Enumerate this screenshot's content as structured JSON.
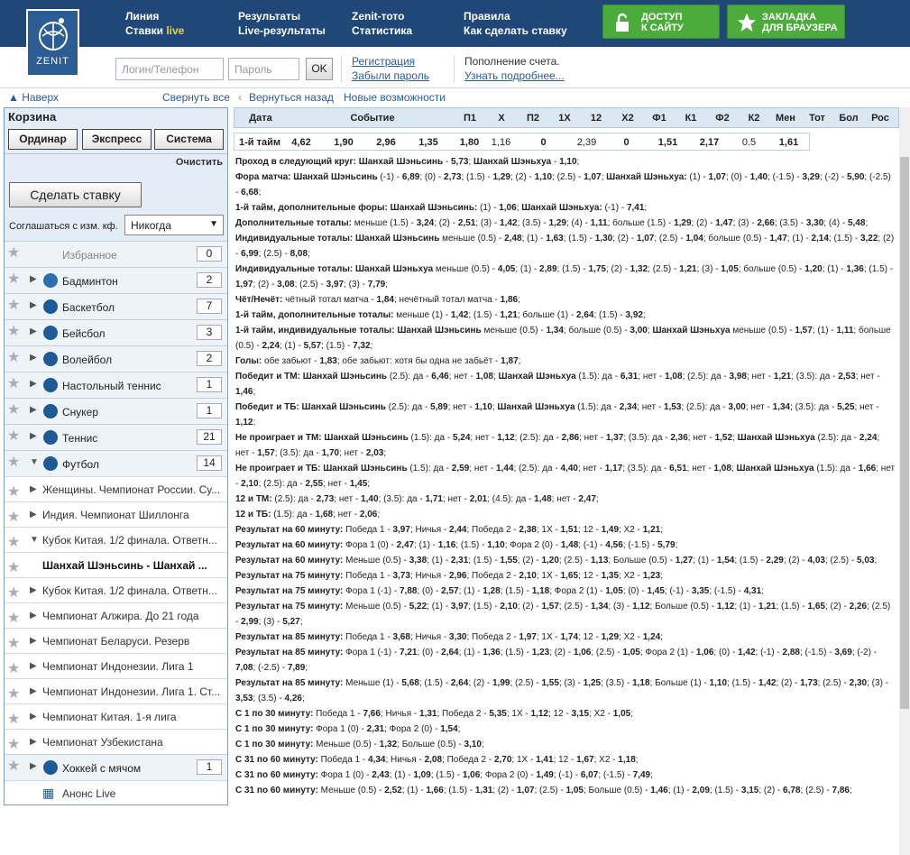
{
  "header": {
    "logo_text": "ZENIT",
    "nav": [
      {
        "l1": "Линия",
        "l2a": "Ставки ",
        "l2b": "live"
      },
      {
        "l1": "Результаты",
        "l2a": "Live-результаты",
        "l2b": ""
      },
      {
        "l1": "Zenit-тото",
        "l2a": "Статистика",
        "l2b": ""
      },
      {
        "l1": "Правила",
        "l2a": "Как сделать ставку",
        "l2b": ""
      }
    ],
    "access_btn": {
      "l1": "Доступ",
      "l2": "к сайту"
    },
    "bookmark_btn": {
      "l1": "Закладка",
      "l2": "для браузера"
    }
  },
  "login": {
    "login_placeholder": "Логин/Телефон",
    "password_placeholder": "Пароль",
    "ok_label": "OK",
    "register": "Регистрация",
    "forgot": "Забыли пароль",
    "topup": "Пополнение счета.",
    "learn_more": "Узнать подробнее..."
  },
  "navrow": {
    "up": "▲ Наверх",
    "collapse": "Свернуть все",
    "back": "Вернуться назад",
    "new_features": "Новые возможности"
  },
  "cart": {
    "title": "Корзина",
    "tabs": [
      "Ординар",
      "Экспресс",
      "Система"
    ],
    "clear": "Очистить",
    "place_bet": "Сделать ставку",
    "agree_label": "Соглашаться с изм. кф.",
    "agree_value": "Никогда"
  },
  "sports": [
    {
      "label": "Избранное",
      "count": "0",
      "color": ""
    },
    {
      "label": "Бадминтон",
      "count": "2",
      "color": "#2b6fb0"
    },
    {
      "label": "Баскетбол",
      "count": "7",
      "color": "#1e5a96"
    },
    {
      "label": "Бейсбол",
      "count": "3",
      "color": "#1e5a96"
    },
    {
      "label": "Волейбол",
      "count": "2",
      "color": "#1e5a96"
    },
    {
      "label": "Настольный теннис",
      "count": "1",
      "color": "#1e5a96"
    },
    {
      "label": "Снукер",
      "count": "1",
      "color": "#1e5a96"
    },
    {
      "label": "Теннис",
      "count": "21",
      "color": "#1e5a96"
    },
    {
      "label": "Футбол",
      "count": "14",
      "color": "#1e5a96"
    }
  ],
  "leagues": [
    "Женщины. Чемпионат России. Су...",
    "Индия. Чемпионат Шиллонга",
    "Кубок Китая. 1/2 финала. Ответн...",
    "Шанхай Шэньсинь - Шанхай ...",
    "Кубок Китая. 1/2 финала. Ответн...",
    "Чемпионат Алжира. До 21 года",
    "Чемпионат Беларуси. Резерв",
    "Чемпионат Индонезии. Лига 1",
    "Чемпионат Индонезии. Лига 1. Ст...",
    "Чемпионат Китая. 1-я лига",
    "Чемпионат Узбекистана"
  ],
  "hockey": {
    "label": "Хоккей с мячом",
    "count": "1"
  },
  "announce": "Анонс Live",
  "table": {
    "headers": [
      "Дата",
      "Событие",
      "П1",
      "X",
      "П2",
      "1X",
      "12",
      "X2",
      "Ф1",
      "К1",
      "Ф2",
      "К2",
      "Мен",
      "Тот",
      "Бол",
      "Рос"
    ],
    "row": [
      "1-й тайм",
      "4,62",
      "1,90",
      "2,96",
      "1,35",
      "1,80",
      "1,16",
      "0",
      "2,39",
      "0",
      "1,51",
      "2,17",
      "0.5",
      "1,61"
    ]
  },
  "lines": [
    "<b>Проход в следующий круг:</b> <b>Шанхай Шэньсинь</b> - <b>5,73</b>; <b>Шанхай Шэньхуа</b> - <b>1,10</b>;",
    "<b>Фора матча:</b> <b>Шанхай Шэньсинь</b> (-1) - <b>6,89</b>; (0) - <b>2,73</b>; (1.5) - <b>1,29</b>; (2) - <b>1,10</b>; (2.5) - <b>1,07</b>; <b>Шанхай Шэньхуа:</b> (1) - <b>1,07</b>; (0) - <b>1,40</b>; (-1.5) - <b>3,29</b>; (-2) - <b>5,90</b>; (-2.5) - <b>6,68</b>;",
    "<b>1-й тайм, дополнительные форы:</b> <b>Шанхай Шэньсинь:</b> (1) - <b>1,06</b>; <b>Шанхай Шэньхуа:</b> (-1) - <b>7,41</b>;",
    "<b>Дополнительные тоталы:</b> меньше (1.5) - <b>3,24</b>; (2) - <b>2,51</b>; (3) - <b>1,42</b>; (3.5) - <b>1,29</b>; (4) - <b>1,11</b>; больше (1.5) - <b>1,29</b>; (2) - <b>1,47</b>; (3) - <b>2,66</b>; (3.5) - <b>3,30</b>; (4) - <b>5,48</b>;",
    "<b>Индивидуальные тоталы:</b> <b>Шанхай Шэньсинь</b> меньше (0.5) - <b>2,48</b>; (1) - <b>1,63</b>; (1.5) - <b>1,30</b>; (2) - <b>1,07</b>; (2.5) - <b>1,04</b>; больше (0.5) - <b>1,47</b>; (1) - <b>2,14</b>; (1.5) - <b>3,22</b>; (2) - <b>6,99</b>; (2.5) - <b>8,08</b>;",
    "<b>Индивидуальные тоталы:</b> <b>Шанхай Шэньхуа</b> меньше (0.5) - <b>4,05</b>; (1) - <b>2,89</b>; (1.5) - <b>1,75</b>; (2) - <b>1,32</b>; (2.5) - <b>1,21</b>; (3) - <b>1,05</b>; больше (0.5) - <b>1,20</b>; (1) - <b>1,36</b>; (1.5) - <b>1,97</b>; (2) - <b>3,08</b>; (2.5) - <b>3,97</b>; (3) - <b>7,79</b>;",
    "<b>Чёт/Нечёт:</b> чётный тотал матча - <b>1,84</b>; нечётный тотал матча - <b>1,86</b>;",
    "<b>1-й тайм, дополнительные тоталы:</b> меньше (1) - <b>1,42</b>; (1.5) - <b>1,21</b>; больше (1) - <b>2,64</b>; (1.5) - <b>3,92</b>;",
    "<b>1-й тайм, индивидуальные тоталы:</b> <b>Шанхай Шэньсинь</b> меньше (0.5) - <b>1,34</b>; больше (0.5) - <b>3,00</b>; <b>Шанхай Шэньхуа</b> меньше (0.5) - <b>1,57</b>; (1) - <b>1,11</b>; больше (0.5) - <b>2,24</b>; (1) - <b>5,57</b>; (1.5) - <b>7,32</b>;",
    "<b>Голы:</b> обе забьют - <b>1,83</b>; обе забьют: хотя бы одна не забьёт - <b>1,87</b>;",
    "<b>Победит и ТМ:</b> <b>Шанхай Шэньсинь</b> (2.5): да - <b>6,46</b>; нет - <b>1,08</b>; <b>Шанхай Шэньхуа</b> (1.5): да - <b>6,31</b>; нет - <b>1,08</b>; (2.5): да - <b>3,98</b>; нет - <b>1,21</b>; (3.5): да - <b>2,53</b>; нет - <b>1,46</b>;",
    "<b>Победит и ТБ:</b> <b>Шанхай Шэньсинь</b> (2.5): да - <b>5,89</b>; нет - <b>1,10</b>; <b>Шанхай Шэньхуа</b> (1.5): да - <b>2,34</b>; нет - <b>1,53</b>; (2.5): да - <b>3,00</b>; нет - <b>1,34</b>; (3.5): да - <b>5,25</b>; нет - <b>1,12</b>;",
    "<b>Не проиграет и ТМ:</b> <b>Шанхай Шэньсинь</b> (1.5): да - <b>5,24</b>; нет - <b>1,12</b>; (2.5): да - <b>2,86</b>; нет - <b>1,37</b>; (3.5): да - <b>2,36</b>; нет - <b>1,52</b>; <b>Шанхай Шэньхуа</b> (2.5): да - <b>2,24</b>; нет - <b>1,57</b>; (3.5): да - <b>1,70</b>; нет - <b>2,03</b>;",
    "<b>Не проиграет и ТБ:</b> <b>Шанхай Шэньсинь</b> (1.5): да - <b>2,59</b>; нет - <b>1,44</b>; (2.5): да - <b>4,40</b>; нет - <b>1,17</b>; (3.5): да - <b>6,51</b>; нет - <b>1,08</b>; <b>Шанхай Шэньхуа</b> (1.5): да - <b>1,66</b>; нет - <b>2,10</b>; (2.5): да - <b>2,55</b>; нет - <b>1,45</b>;",
    "<b>12 и ТМ:</b> (2.5): да - <b>2,73</b>; нет - <b>1,40</b>; (3.5): да - <b>1,71</b>; нет - <b>2,01</b>; (4.5): да - <b>1,48</b>; нет - <b>2,47</b>;",
    "<b>12 и ТБ:</b> (1.5): да - <b>1,68</b>; нет - <b>2,06</b>;",
    "<b>Результат на 60 минуту:</b> Победа 1 - <b>3,97</b>; Ничья - <b>2,44</b>; Победа 2 - <b>2,38</b>; 1X - <b>1,51</b>; 12 - <b>1,49</b>; X2 - <b>1,21</b>;",
    "<b>Результат на 60 минуту:</b> Фора 1 (0) - <b>2,47</b>; (1) - <b>1,16</b>; (1.5) - <b>1,10</b>; Фора 2 (0) - <b>1,48</b>; (-1) - <b>4,56</b>; (-1.5) - <b>5,79</b>;",
    "<b>Результат на 60 минуту:</b> Меньше (0.5) - <b>3,38</b>; (1) - <b>2,31</b>; (1.5) - <b>1,55</b>; (2) - <b>1,20</b>; (2.5) - <b>1,13</b>; Больше (0.5) - <b>1,27</b>; (1) - <b>1,54</b>; (1.5) - <b>2,29</b>; (2) - <b>4,03</b>; (2.5) - <b>5,03</b>;",
    "<b>Результат на 75 минуту:</b> Победа 1 - <b>3,73</b>; Ничья - <b>2,96</b>; Победа 2 - <b>2,10</b>; 1X - <b>1,65</b>; 12 - <b>1,35</b>; X2 - <b>1,23</b>;",
    "<b>Результат на 75 минуту:</b> Фора 1 (-1) - <b>7,88</b>; (0) - <b>2,57</b>; (1) - <b>1,28</b>; (1.5) - <b>1,18</b>; Фора 2 (1) - <b>1,05</b>; (0) - <b>1,45</b>; (-1) - <b>3,35</b>; (-1.5) - <b>4,31</b>;",
    "<b>Результат на 75 минуту:</b> Меньше (0.5) - <b>5,22</b>; (1) - <b>3,97</b>; (1.5) - <b>2,10</b>; (2) - <b>1,57</b>; (2.5) - <b>1,34</b>; (3) - <b>1,12</b>; Больше (0.5) - <b>1,12</b>; (1) - <b>1,21</b>; (1.5) - <b>1,65</b>; (2) - <b>2,26</b>; (2.5) - <b>2,99</b>; (3) - <b>5,27</b>;",
    "<b>Результат на 85 минуту:</b> Победа 1 - <b>3,68</b>; Ничья - <b>3,30</b>; Победа 2 - <b>1,97</b>; 1X - <b>1,74</b>; 12 - <b>1,29</b>; X2 - <b>1,24</b>;",
    "<b>Результат на 85 минуту:</b> Фора 1 (-1) - <b>7,21</b>; (0) - <b>2,64</b>; (1) - <b>1,36</b>; (1.5) - <b>1,23</b>; (2) - <b>1,06</b>; (2.5) - <b>1,05</b>; Фора 2 (1) - <b>1,06</b>; (0) - <b>1,42</b>; (-1) - <b>2,88</b>; (-1.5) - <b>3,69</b>; (-2) - <b>7,08</b>; (-2.5) - <b>7,89</b>;",
    "<b>Результат на 85 минуту:</b> Меньше (1) - <b>5,68</b>; (1.5) - <b>2,64</b>; (2) - <b>1,99</b>; (2.5) - <b>1,55</b>; (3) - <b>1,25</b>; (3.5) - <b>1,18</b>; Больше (1) - <b>1,10</b>; (1.5) - <b>1,42</b>; (2) - <b>1,73</b>; (2.5) - <b>2,30</b>; (3) - <b>3,53</b>; (3.5) - <b>4,26</b>;",
    "<b>С 1 по 30 минуту:</b> Победа 1 - <b>7,66</b>; Ничья - <b>1,31</b>; Победа 2 - <b>5,35</b>; 1X - <b>1,12</b>; 12 - <b>3,15</b>; X2 - <b>1,05</b>;",
    "<b>С 1 по 30 минуту:</b> Фора 1 (0) - <b>2,31</b>; Фора 2 (0) - <b>1,54</b>;",
    "<b>С 1 по 30 минуту:</b> Меньше (0.5) - <b>1,32</b>; Больше (0.5) - <b>3,10</b>;",
    "<b>С 31 по 60 минуту:</b> Победа 1 - <b>4,34</b>; Ничья - <b>2,08</b>; Победа 2 - <b>2,70</b>; 1X - <b>1,41</b>; 12 - <b>1,67</b>; X2 - <b>1,18</b>;",
    "<b>С 31 по 60 минуту:</b> Фора 1 (0) - <b>2,43</b>; (1) - <b>1,09</b>; (1.5) - <b>1,06</b>; Фора 2 (0) - <b>1,49</b>; (-1) - <b>6,07</b>; (-1.5) - <b>7,49</b>;",
    "<b>С 31 по 60 минуту:</b> Меньше (0.5) - <b>2,52</b>; (1) - <b>1,66</b>; (1.5) - <b>1,31</b>; (2) - <b>1,07</b>; (2.5) - <b>1,05</b>; Больше (0.5) - <b>1,46</b>; (1) - <b>2,09</b>; (1.5) - <b>3,15</b>; (2) - <b>6,78</b>; (2.5) - <b>7,86</b>;"
  ]
}
